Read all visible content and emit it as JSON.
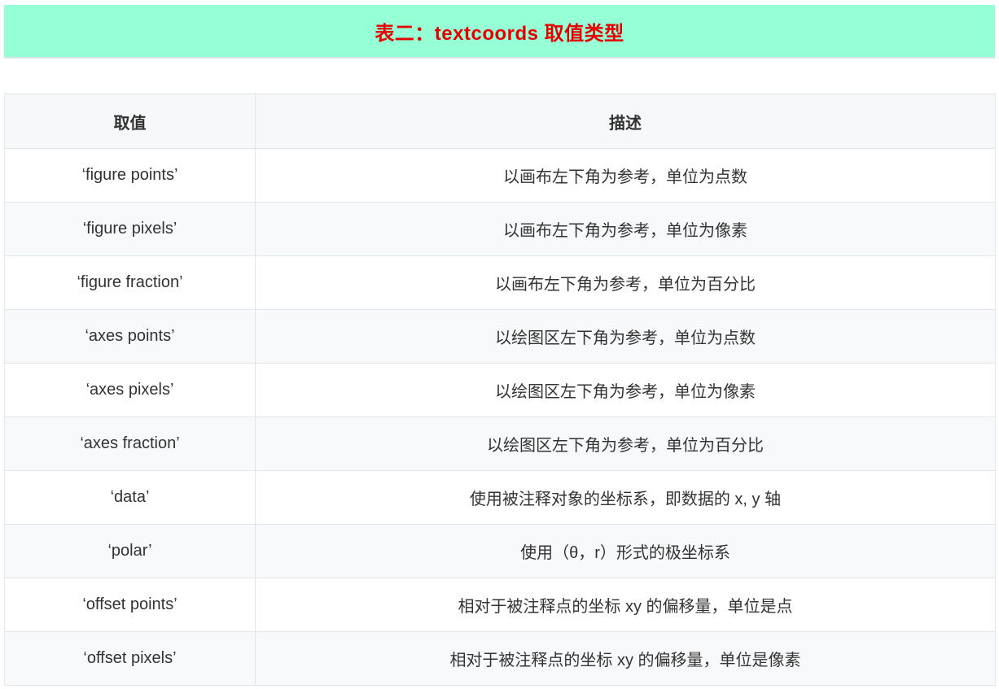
{
  "title": "表二：textcoords 取值类型",
  "table": {
    "headers": [
      "取值",
      "描述"
    ],
    "rows": [
      {
        "value": "‘figure points’",
        "desc": "以画布左下角为参考，单位为点数"
      },
      {
        "value": "‘figure pixels’",
        "desc": "以画布左下角为参考，单位为像素"
      },
      {
        "value": "‘figure fraction’",
        "desc": "以画布左下角为参考，单位为百分比"
      },
      {
        "value": "‘axes points’",
        "desc": "以绘图区左下角为参考，单位为点数"
      },
      {
        "value": "‘axes pixels’",
        "desc": "以绘图区左下角为参考，单位为像素"
      },
      {
        "value": "‘axes fraction’",
        "desc": "以绘图区左下角为参考，单位为百分比"
      },
      {
        "value": "‘data’",
        "desc": "使用被注释对象的坐标系，即数据的 x, y 轴"
      },
      {
        "value": "‘polar’",
        "desc": "使用（θ，r）形式的极坐标系"
      },
      {
        "value": "‘offset points’",
        "desc": "相对于被注释点的坐标 xy 的偏移量，单位是点"
      },
      {
        "value": "‘offset pixels’",
        "desc": "相对于被注释点的坐标 xy 的偏移量，单位是像素"
      }
    ]
  },
  "colors": {
    "banner_background": "#96ffd6",
    "title_text": "#e60000",
    "header_background": "#f6f8fa",
    "border": "#e2e6ea"
  }
}
